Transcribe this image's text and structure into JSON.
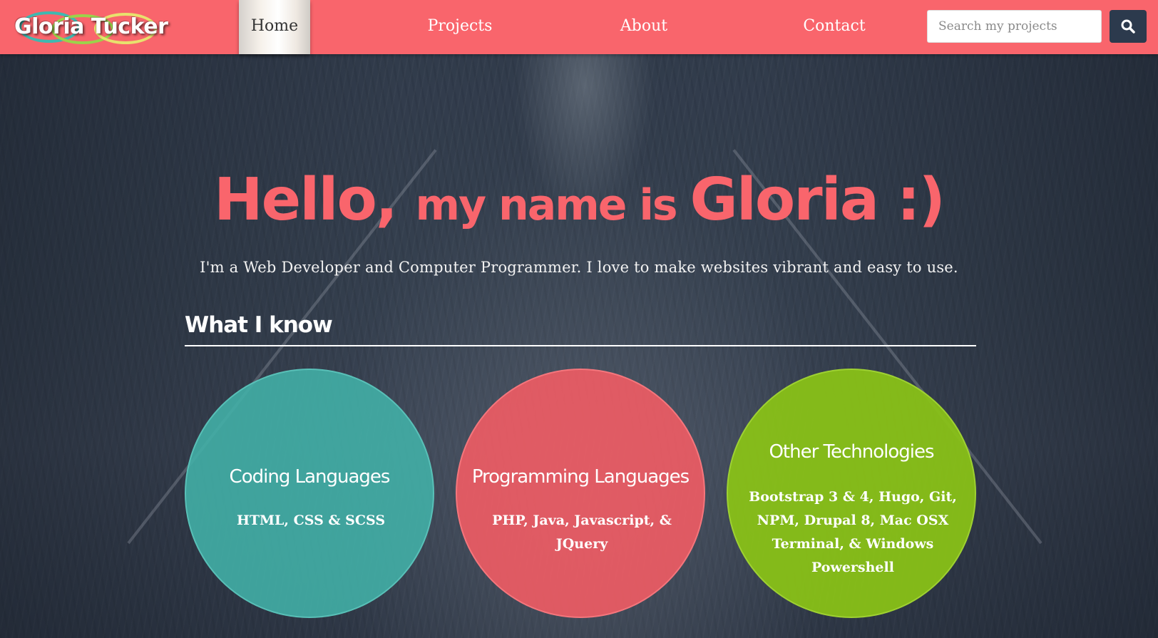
{
  "navbar": {
    "brand": "Gloria Tucker",
    "items": [
      {
        "label": "Home",
        "active": true
      },
      {
        "label": "Projects"
      },
      {
        "label": "About"
      },
      {
        "label": "Contact"
      }
    ],
    "search": {
      "placeholder": "Search my projects",
      "value": "",
      "button_icon": "search-icon"
    }
  },
  "hero": {
    "greeting_1": "Hello, ",
    "greeting_2": "my name is ",
    "greeting_3": "Gloria :)",
    "subtitle": "I'm a Web Developer and Computer Programmer. I love to make websites vibrant and easy to use."
  },
  "skills": {
    "heading": "What I know",
    "cards": [
      {
        "title": "Coding Languages",
        "body": "HTML, CSS & SCSS",
        "color": "#42b2a8"
      },
      {
        "title": "Programming Languages",
        "body": "PHP, Java, Javascript, & JQuery",
        "color": "#f55c64"
      },
      {
        "title": "Other Technologies",
        "body": "Bootstrap 3 & 4, Hugo, Git, NPM, Drupal 8, Mac OSX Terminal, & Windows Powershell",
        "color": "#8bc416"
      }
    ]
  },
  "colors": {
    "navbar": "#f9656c",
    "accent": "#f9656c",
    "search_button": "#2c3a4d"
  }
}
